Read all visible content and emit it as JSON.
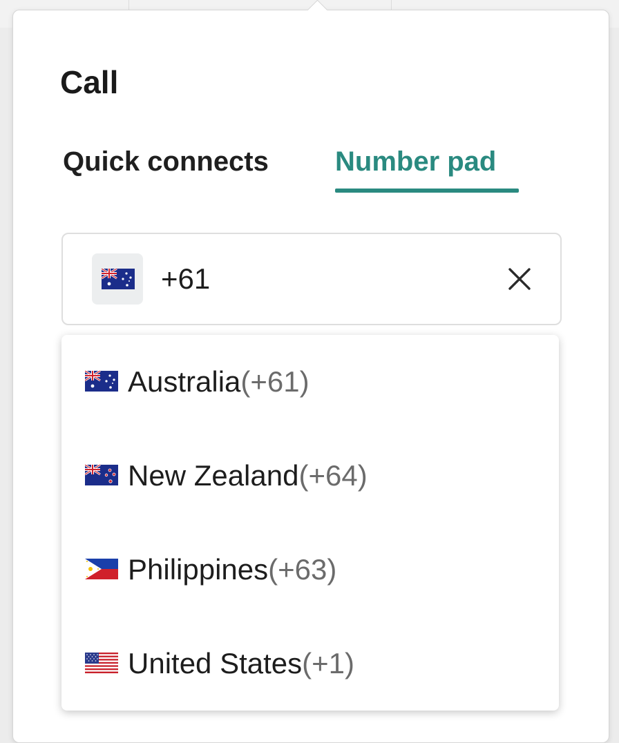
{
  "dialog": {
    "title": "Call"
  },
  "tabs": [
    {
      "label": "Quick connects",
      "active": false
    },
    {
      "label": "Number pad",
      "active": true
    }
  ],
  "accent_color": "#2a8a80",
  "phone_input": {
    "flag_icon": "australia-flag-icon",
    "value": "+61",
    "clear_icon": "close-icon"
  },
  "country_options": [
    {
      "name": "Australia",
      "code": "(+61)",
      "flag_icon": "australia-flag-icon"
    },
    {
      "name": "New Zealand",
      "code": "(+64)",
      "flag_icon": "new-zealand-flag-icon"
    },
    {
      "name": "Philippines",
      "code": "(+63)",
      "flag_icon": "philippines-flag-icon"
    },
    {
      "name": "United States",
      "code": "(+1)",
      "flag_icon": "united-states-flag-icon"
    }
  ]
}
